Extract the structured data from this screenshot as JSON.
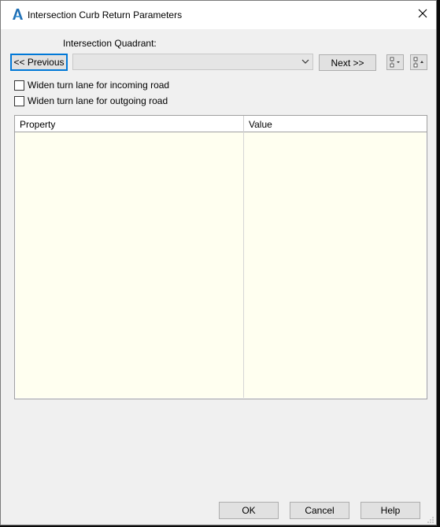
{
  "window": {
    "title": "Intersection Curb Return Parameters"
  },
  "quadrant": {
    "label": "Intersection Quadrant:",
    "selected_value": ""
  },
  "navigation": {
    "previous_label": "<< Previous",
    "next_label": "Next >>"
  },
  "options": [
    {
      "label": "Widen turn lane for incoming road",
      "checked": false
    },
    {
      "label": "Widen turn lane for outgoing road",
      "checked": false
    }
  ],
  "grid": {
    "columns": [
      "Property",
      "Value"
    ],
    "rows": []
  },
  "footer": {
    "ok_label": "OK",
    "cancel_label": "Cancel",
    "help_label": "Help"
  },
  "colors": {
    "accent": "#0078d7",
    "grid_background": "#fffff0",
    "dialog_background": "#f0f0f0"
  },
  "icons": {
    "app": "autocad-a-icon",
    "close": "close-icon",
    "combo_arrow": "chevron-down-icon",
    "toolbar_1": "property-layout-icon",
    "toolbar_2": "collapse-expand-icon"
  }
}
